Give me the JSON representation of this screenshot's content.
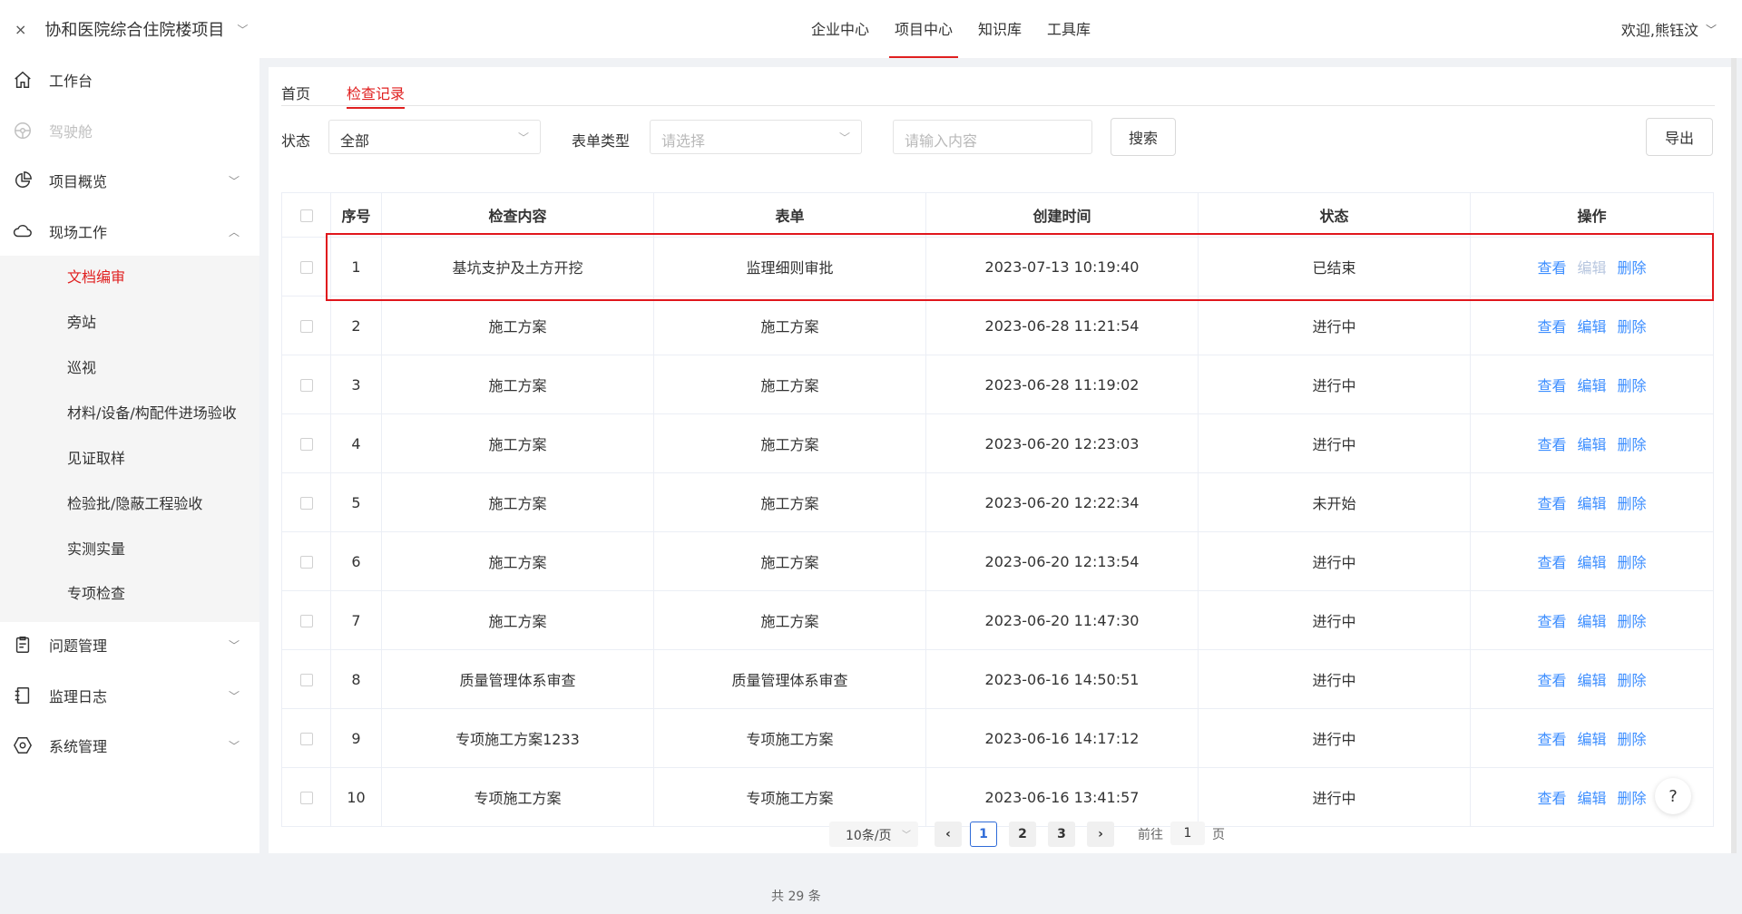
{
  "header": {
    "close_symbol": "×",
    "project_name": "协和医院综合住院楼项目",
    "nav": [
      {
        "label": "企业中心"
      },
      {
        "label": "项目中心"
      },
      {
        "label": "知识库"
      },
      {
        "label": "工具库"
      }
    ],
    "welcome": "欢迎,熊钰汶",
    "accent_color": "#e02020"
  },
  "sidebar": {
    "workbench": "工作台",
    "cockpit": "驾驶舱",
    "overview": "项目概览",
    "field_work": "现场工作",
    "sub_items": [
      "文档编审",
      "旁站",
      "巡视",
      "材料/设备/构配件进场验收",
      "见证取样",
      "检验批/隐蔽工程验收",
      "实测实量",
      "专项检查"
    ],
    "issues": "问题管理",
    "log": "监理日志",
    "system": "系统管理"
  },
  "tabs": [
    "首页",
    "检查记录"
  ],
  "filters": {
    "status_label": "状态",
    "status_value": "全部",
    "form_type_label": "表单类型",
    "form_type_placeholder": "请选择",
    "keyword_placeholder": "请输入内容",
    "search_label": "搜索",
    "export_label": "导出"
  },
  "table": {
    "headers": [
      "序号",
      "检查内容",
      "表单",
      "创建时间",
      "状态",
      "操作"
    ],
    "actions": {
      "view": "查看",
      "edit": "编辑",
      "delete": "删除"
    },
    "rows": [
      {
        "no": "1",
        "content": "基坑支护及土方开挖",
        "form": "监理细则审批",
        "created": "2023-07-13 10:19:40",
        "status": "已结束"
      },
      {
        "no": "2",
        "content": "施工方案",
        "form": "施工方案",
        "created": "2023-06-28 11:21:54",
        "status": "进行中"
      },
      {
        "no": "3",
        "content": "施工方案",
        "form": "施工方案",
        "created": "2023-06-28 11:19:02",
        "status": "进行中"
      },
      {
        "no": "4",
        "content": "施工方案",
        "form": "施工方案",
        "created": "2023-06-20 12:23:03",
        "status": "进行中"
      },
      {
        "no": "5",
        "content": "施工方案",
        "form": "施工方案",
        "created": "2023-06-20 12:22:34",
        "status": "未开始"
      },
      {
        "no": "6",
        "content": "施工方案",
        "form": "施工方案",
        "created": "2023-06-20 12:13:54",
        "status": "进行中"
      },
      {
        "no": "7",
        "content": "施工方案",
        "form": "施工方案",
        "created": "2023-06-20 11:47:30",
        "status": "进行中"
      },
      {
        "no": "8",
        "content": "质量管理体系审查",
        "form": "质量管理体系审查",
        "created": "2023-06-16 14:50:51",
        "status": "进行中"
      },
      {
        "no": "9",
        "content": "专项施工方案1233",
        "form": "专项施工方案",
        "created": "2023-06-16 14:17:12",
        "status": "进行中"
      },
      {
        "no": "10",
        "content": "专项施工方案",
        "form": "专项施工方案",
        "created": "2023-06-16 13:41:57",
        "status": "进行中"
      }
    ]
  },
  "pagination": {
    "total": "共 29 条",
    "page_size": "10条/页",
    "pages": [
      "1",
      "2",
      "3"
    ],
    "prev": "‹",
    "next": "›",
    "goto_prefix": "前往",
    "goto_value": "1",
    "goto_suffix": "页"
  },
  "help_label": "?"
}
